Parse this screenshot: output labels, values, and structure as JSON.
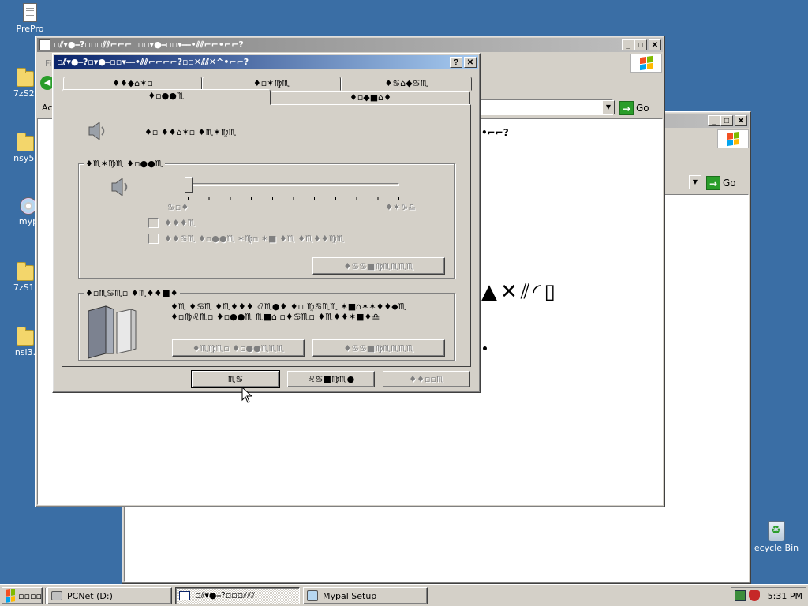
{
  "desktop": {
    "icons": [
      {
        "label": "PrePro"
      },
      {
        "label": "7zS2."
      },
      {
        "label": "nsy5."
      },
      {
        "label": "myp"
      },
      {
        "label": "7zS1."
      },
      {
        "label": "nsl3."
      },
      {
        "label": "ecycle Bin"
      }
    ]
  },
  "back_window": {
    "title": "",
    "go_label": "Go"
  },
  "middle_window": {
    "title": "▫⫽▾●⎯?▫▫▫⫽⫽⌐⌐⌐▫▫▫▾●⎯▫▫▾⎯⎯•⫽⫽⌐⌐•⌐⌐?",
    "menu_first": "Fi",
    "address_label": "Ac",
    "go_label": "Go",
    "body_text": "•⌐⌐?",
    "large_glyphs": "▲✕⫽◜▯"
  },
  "dialog": {
    "title": "▫⫽▾●⎯?▫▾●⎯▫▫▾⎯⎯•⫽⫽⌐⌐⌐⌐?▫▫✕⫽⫽✕^•⌐⌐?",
    "help": "?",
    "close": "✕",
    "tabs_row1": [
      "♦♦◆⌂✶▫",
      "♦▫✶♍♏",
      "♦♋⌂◆♋♏"
    ],
    "tabs_row2": [
      "♦▫●●♏",
      "♦▫◆■⌂♦"
    ],
    "device_volume_label": "♦▫ ♦♦⌂✶▫ ♦♏✶♍♏",
    "group1": {
      "legend": "♦♏✶♍♏ ♦▫●●♏",
      "slider_level_pct": 0,
      "slider_low": "♋▫♦",
      "slider_high": "♦✶♑♎",
      "mute_label": "♦♦♦♏",
      "tray_label": "♦♦♋♏ ♦▫●●♏ ✶♍▫ ✶■ ♦♏ ♦♏♦♦♍♏",
      "advanced_btn": "♦♋♋■♍♏♏♏♏"
    },
    "group2": {
      "legend": "♦▫♏♋♏▫ ♦♏♦♦■♦",
      "description": "♦♏ ♦♋♏ ♦♏♦♦♦ ♌♏●♦ ♦▫ ♍♋♏♏ ✶■⌂✶✶♦♦◆♏ ♦▫♍♌♏▫ ♦▫●●♏ ♏■⌂ ▫♦♋♏▫ ♦♏♦♦✶■♦♎",
      "volume_btn": "♦♏♍♏▫ ♦▫●●♏♏♏",
      "advanced_btn": "♦♋♋■♍♏♏♏♏"
    },
    "buttons": {
      "ok": "♏♋",
      "cancel": "♌♋■♍♏●",
      "apply": "♦♦▫▫♏"
    }
  },
  "taskbar": {
    "start_label": "▫▫▫▫",
    "tasks": [
      {
        "label": "PCNet (D:)"
      },
      {
        "label": "▫⫽▾●⎯?▫▫▫⫽⫽⫽"
      },
      {
        "label": "Mypal Setup"
      }
    ],
    "clock": "5:31 PM"
  },
  "colors": {
    "desktop": "#3a6ea5",
    "title_active_start": "#0a246a",
    "title_active_end": "#a6caf0",
    "face": "#d4d0c8"
  }
}
